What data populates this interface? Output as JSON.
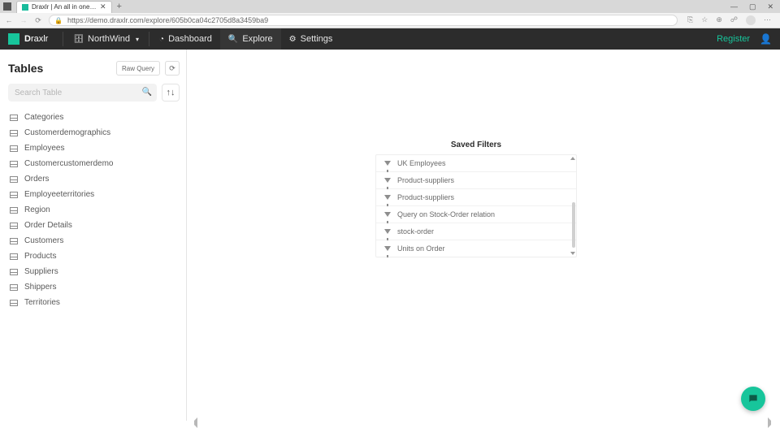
{
  "browser": {
    "tab_title": "Draxlr | An all in one platform to",
    "url": "https://demo.draxlr.com/explore/605b0ca04c2705d8a3459ba9",
    "window_controls": {
      "min": "—",
      "max": "▢",
      "close": "✕"
    }
  },
  "nav": {
    "brand_first": "D",
    "brand_rest": "raxlr",
    "db_label": "NorthWind",
    "dashboard": "Dashboard",
    "explore": "Explore",
    "settings": "Settings",
    "register": "Register"
  },
  "sidebar": {
    "title": "Tables",
    "raw_query": "Raw Query",
    "search_placeholder": "Search Table",
    "tables": [
      "Categories",
      "Customerdemographics",
      "Employees",
      "Customercustomerdemo",
      "Orders",
      "Employeeterritories",
      "Region",
      "Order Details",
      "Customers",
      "Products",
      "Suppliers",
      "Shippers",
      "Territories"
    ]
  },
  "saved": {
    "title": "Saved Filters",
    "items": [
      "UK Employees",
      "Product-suppliers",
      "Product-suppliers",
      "Query on Stock-Order relation",
      "stock-order",
      "Units on Order"
    ]
  }
}
